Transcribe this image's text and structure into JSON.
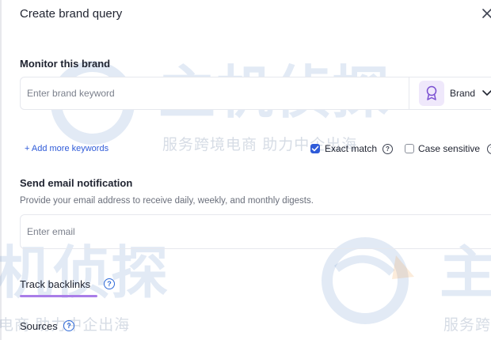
{
  "dialog": {
    "title": "Create brand query"
  },
  "monitor": {
    "label": "Monitor this brand",
    "keyword_placeholder": "Enter brand keyword",
    "keyword_value": "",
    "type_selected": "Brand",
    "add_more_label": "+ Add more keywords",
    "exact_match": {
      "label": "Exact match",
      "checked": true
    },
    "case_sensitive": {
      "label": "Case sensitive",
      "checked": false
    }
  },
  "email": {
    "label": "Send email notification",
    "help": "Provide your email address to receive daily, weekly, and monthly digests.",
    "placeholder": "Enter email",
    "value": ""
  },
  "backlinks": {
    "label": "Track backlinks"
  },
  "sources": {
    "label": "Sources"
  },
  "watermark": {
    "brand_cn": "主机侦探",
    "slogan_cn": "服务跨境电商 助力中企出海",
    "slogan_cn_short": "服务跨",
    "slogan_cn_tail": "电商 助力中企出海",
    "brand_cn_tail": "机侦探",
    "brand_cn_head": "主"
  },
  "colors": {
    "accent": "#2f5bd8",
    "underline": "#a97de8",
    "brand_icon_bg": "#efe8fb"
  }
}
